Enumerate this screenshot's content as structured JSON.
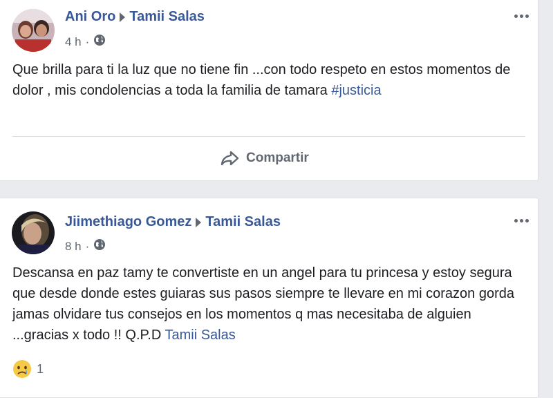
{
  "posts": [
    {
      "author": "Ani Oro",
      "target": "Tamii Salas",
      "time": "4 h",
      "separator": "·",
      "text": "Que brilla para ti la luz que no tiene fin ...con todo respeto en estos momentos de dolor , mis condolencias a toda la familia de tamara ",
      "hashtag": "#justicia",
      "share_label": "Compartir",
      "avatar_icon": "profile-photo",
      "privacy_icon": "globe-icon"
    },
    {
      "author": "Jiimethiago Gomez",
      "target": "Tamii Salas",
      "time": "8 h",
      "separator": "·",
      "text": "Descansa en paz tamy te convertiste en un angel para tu princesa y estoy segura que desde donde estes guiaras sus pasos siempre te llevare en mi corazon gorda jamas olvidare tus consejos en los momentos q mas necesitaba de alguien ...gracias x todo !! Q.P.D ",
      "mention": "Tamii Salas",
      "reaction_icon": "sad-emoji-icon",
      "reaction_count": "1",
      "avatar_icon": "profile-photo",
      "privacy_icon": "globe-icon"
    }
  ],
  "colors": {
    "link": "#385898",
    "text": "#1c1e21",
    "muted": "#606770",
    "background": "#e9ebee"
  }
}
